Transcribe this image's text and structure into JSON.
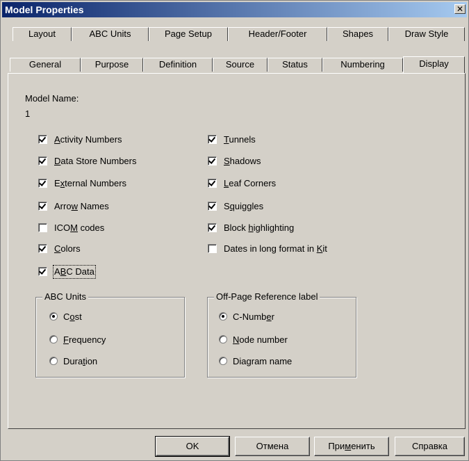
{
  "window": {
    "title": "Model Properties",
    "close_glyph": "✕"
  },
  "tabs_row1": [
    "Layout",
    "ABC Units",
    "Page Setup",
    "Header/Footer",
    "Shapes",
    "Draw Style"
  ],
  "tabs_row2": [
    "General",
    "Purpose",
    "Definition",
    "Source",
    "Status",
    "Numbering",
    "Display"
  ],
  "active_tab": "Display",
  "model": {
    "name_label": "Model Name:",
    "name_value": "1"
  },
  "left_checks": [
    {
      "label": "Activity Numbers",
      "checked": true
    },
    {
      "label": "Data Store Numbers",
      "checked": true
    },
    {
      "label": "External Numbers",
      "checked": true
    },
    {
      "label": "Arrow Names",
      "checked": true
    },
    {
      "label": "ICOM codes",
      "checked": false
    },
    {
      "label": "Colors",
      "checked": true
    },
    {
      "label": "ABC Data",
      "checked": true
    }
  ],
  "right_checks": [
    {
      "label": "Tunnels",
      "checked": true
    },
    {
      "label": "Shadows",
      "checked": true
    },
    {
      "label": "Leaf Corners",
      "checked": true
    },
    {
      "label": "Squiggles",
      "checked": true
    },
    {
      "label": "Block highlighting",
      "checked": true
    },
    {
      "label": "Dates in long format in Kit",
      "checked": false
    }
  ],
  "abc_units": {
    "legend": "ABC Units",
    "options": [
      "Cost",
      "Frequency",
      "Duration"
    ],
    "selected": "Cost"
  },
  "offpage": {
    "legend": "Off-Page Reference label",
    "options": [
      "C-Number",
      "Node number",
      "Diagram name"
    ],
    "selected": "C-Number"
  },
  "buttons": {
    "ok": "OK",
    "cancel": "Отмена",
    "apply": "Применить",
    "help": "Справка"
  }
}
